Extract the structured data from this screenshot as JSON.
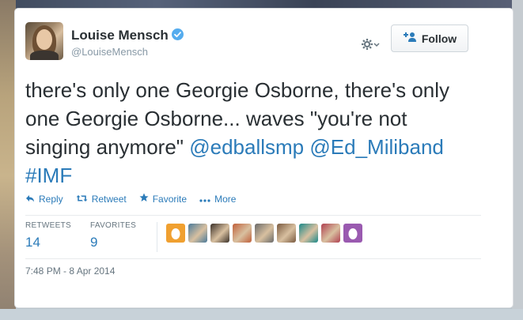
{
  "user": {
    "name": "Louise Mensch",
    "handle": "@LouiseMensch",
    "verified": true
  },
  "header": {
    "follow_label": "Follow",
    "gear_icon": "gear-icon",
    "follow_icon": "add-user-icon"
  },
  "tweet": {
    "text_plain": "there's only one Georgie Osborne, there's only one Georgie Osborne... waves \"you're not singing anymore\" ",
    "mention1": "@edballsmp",
    "mention2": "@Ed_Miliband",
    "hashtag": "#IMF"
  },
  "actions": {
    "reply": "Reply",
    "retweet": "Retweet",
    "favorite": "Favorite",
    "more": "More"
  },
  "stats": {
    "retweets_label": "RETWEETS",
    "retweets_value": "14",
    "favorites_label": "FAVORITES",
    "favorites_value": "9"
  },
  "favoriters": [
    {
      "color": "#f0a030",
      "icon": "egg-avatar"
    },
    {
      "color": "#4a7a9a",
      "icon": "avatar"
    },
    {
      "color": "#3a3028",
      "icon": "avatar"
    },
    {
      "color": "#c0603a",
      "icon": "avatar"
    },
    {
      "color": "#6a6a6a",
      "icon": "avatar"
    },
    {
      "color": "#7a5a40",
      "icon": "avatar"
    },
    {
      "color": "#1a8a8a",
      "icon": "avatar"
    },
    {
      "color": "#b04050",
      "icon": "avatar"
    },
    {
      "color": "#9a5ab0",
      "icon": "egg-avatar"
    }
  ],
  "timestamp": "7:48 PM - 8 Apr 2014",
  "colors": {
    "link": "#2b7bb9",
    "verified": "#55acee",
    "text": "#292f33"
  }
}
